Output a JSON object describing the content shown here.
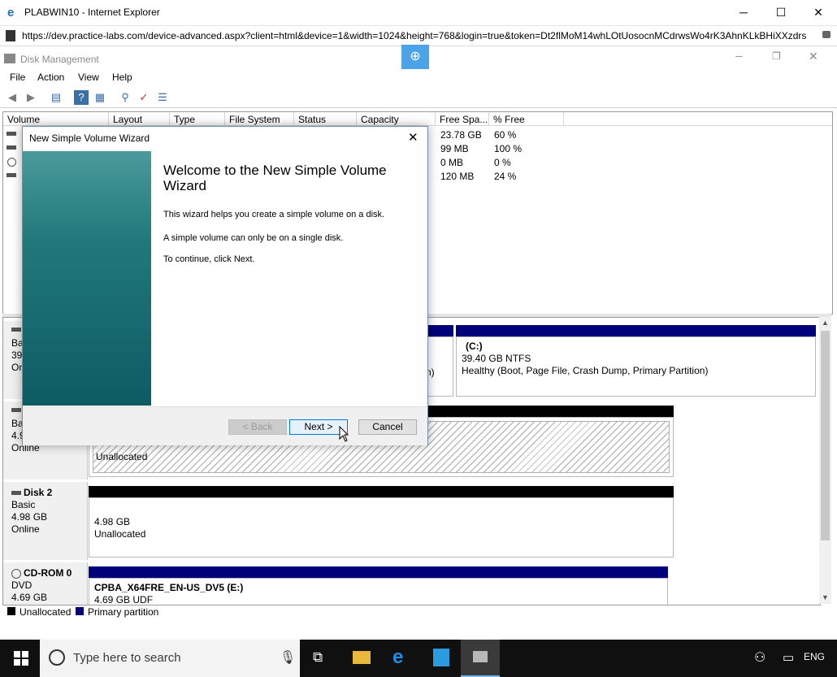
{
  "ie": {
    "title": "PLABWIN10 - Internet Explorer",
    "url": "https://dev.practice-labs.com/device-advanced.aspx?client=html&device=1&width=1024&height=768&login=true&token=Dt2flMoM14whLOtUosocnMCdrwsWo4rK3AhnKLkBHiXXzdrs",
    "minimize": "─",
    "maximize": "☐",
    "close": "✕"
  },
  "disk_mgmt": {
    "title": "Disk Management",
    "menus": [
      "File",
      "Action",
      "View",
      "Help"
    ]
  },
  "volume_table": {
    "columns": [
      "Volume",
      "Layout",
      "Type",
      "File System",
      "Status",
      "Capacity",
      "Free Spa...",
      "% Free"
    ],
    "rows": [
      {
        "free": "23.78 GB",
        "pct": "60 %"
      },
      {
        "free": "99 MB",
        "pct": "100 %"
      },
      {
        "free": "0 MB",
        "pct": "0 %"
      },
      {
        "free": "120 MB",
        "pct": "24 %"
      }
    ]
  },
  "disks": {
    "disk0": {
      "label": "Ba",
      "size": "39.",
      "status": "Onl",
      "partial_text": "n)",
      "c_title": "(C:)",
      "c_size": "39.40 GB NTFS",
      "c_status": "Healthy (Boot, Page File, Crash Dump, Primary Partition)"
    },
    "disk1": {
      "label": "Ba",
      "size": "4.9",
      "status": "Online",
      "part_text": "Unallocated"
    },
    "disk2": {
      "name": "Disk 2",
      "type": "Basic",
      "size": "4.98 GB",
      "status": "Online",
      "part_size": "4.98 GB",
      "part_text": "Unallocated"
    },
    "cdrom": {
      "name": "CD-ROM 0",
      "type": "DVD",
      "size": "4.69 GB",
      "vol_title": "CPBA_X64FRE_EN-US_DV5  (E:)",
      "vol_size": "4.69 GB UDF"
    }
  },
  "legend": {
    "unallocated": "Unallocated",
    "primary": "Primary partition"
  },
  "wizard": {
    "title": "New Simple Volume Wizard",
    "heading": "Welcome to the New Simple Volume Wizard",
    "line1": "This wizard helps you create a simple volume on a disk.",
    "line2": "A simple volume can only be on a single disk.",
    "line3": "To continue, click Next.",
    "back": "< Back",
    "next": "Next >",
    "cancel": "Cancel"
  },
  "taskbar": {
    "search_placeholder": "Type here to search",
    "lang": "ENG"
  },
  "colors": {
    "navy": "#01017c",
    "banner_teal": "#21787a",
    "taskbar": "#101010"
  }
}
